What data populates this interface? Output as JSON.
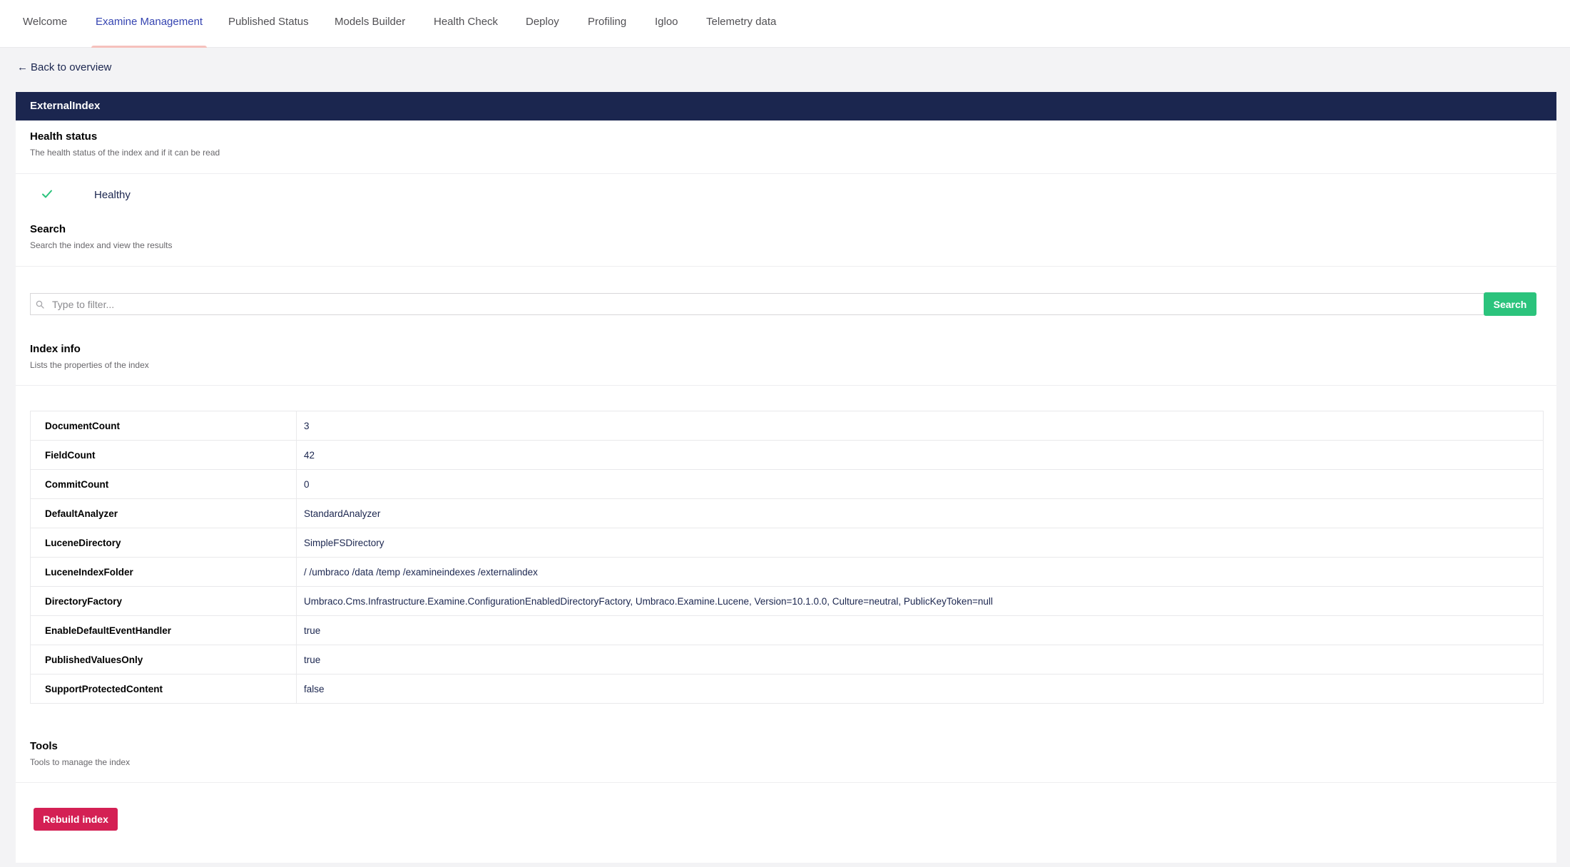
{
  "tabs": [
    {
      "label": "Welcome",
      "active": false
    },
    {
      "label": "Examine Management",
      "active": true
    },
    {
      "label": "Published Status",
      "active": false
    },
    {
      "label": "Models Builder",
      "active": false
    },
    {
      "label": "Health Check",
      "active": false
    },
    {
      "label": "Deploy",
      "active": false
    },
    {
      "label": "Profiling",
      "active": false
    },
    {
      "label": "Igloo",
      "active": false
    },
    {
      "label": "Telemetry data",
      "active": false
    }
  ],
  "back_link": "Back to overview",
  "index": {
    "name": "ExternalIndex",
    "health": {
      "title": "Health status",
      "description": "The health status of the index and if it can be read",
      "status": "Healthy"
    },
    "search": {
      "title": "Search",
      "description": "Search the index and view the results",
      "placeholder": "Type to filter...",
      "button_label": "Search"
    },
    "info": {
      "title": "Index info",
      "description": "Lists the properties of the index",
      "rows": [
        {
          "key": "DocumentCount",
          "value": "3"
        },
        {
          "key": "FieldCount",
          "value": "42"
        },
        {
          "key": "CommitCount",
          "value": "0"
        },
        {
          "key": "DefaultAnalyzer",
          "value": "StandardAnalyzer"
        },
        {
          "key": "LuceneDirectory",
          "value": "SimpleFSDirectory"
        },
        {
          "key": "LuceneIndexFolder",
          "value": "/ /umbraco /data /temp /examineindexes /externalindex"
        },
        {
          "key": "DirectoryFactory",
          "value": "Umbraco.Cms.Infrastructure.Examine.ConfigurationEnabledDirectoryFactory, Umbraco.Examine.Lucene, Version=10.1.0.0, Culture=neutral, PublicKeyToken=null"
        },
        {
          "key": "EnableDefaultEventHandler",
          "value": "true"
        },
        {
          "key": "PublishedValuesOnly",
          "value": "true"
        },
        {
          "key": "SupportProtectedContent",
          "value": "false"
        }
      ]
    },
    "tools": {
      "title": "Tools",
      "description": "Tools to manage the index",
      "rebuild_label": "Rebuild index"
    }
  },
  "colors": {
    "header_navy": "#1b264f",
    "healthy_green": "#2bc37c",
    "danger": "#d42054",
    "active_tab": "#3544b1"
  },
  "icons": {
    "back": "arrow-left-icon",
    "health": "check-icon",
    "search": "search-icon"
  }
}
